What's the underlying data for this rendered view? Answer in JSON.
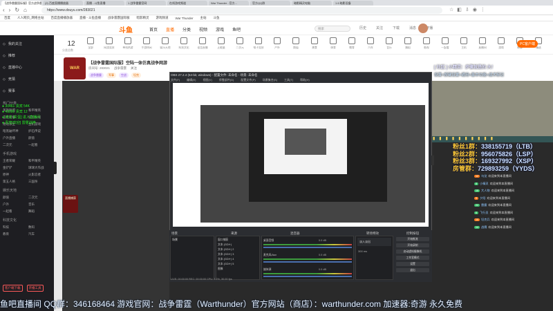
{
  "browser": {
    "tabs": [
      "【战争雷霆国际服】官方战争雷霆...",
      "(2) 百度直播播放器",
      "直播 - 斗鱼直播",
      "1 战争雷霆官网",
      "在线游戏频道",
      "War Thunder - 官方...",
      "官方QQ群",
      "暗影精灵电脑",
      "1 6 暗影设备"
    ],
    "url": "https://www.douyu.com/283021",
    "bookmarks": [
      "百度",
      "人人网页_网络主站",
      "百度直播播放器",
      "直播 - 斗鱼直播",
      "战争雷霆国际服",
      "暗影精灵",
      "游戏频道",
      "War Thunder",
      "主站",
      "斗鱼"
    ]
  },
  "site": {
    "logo": "斗鱼",
    "nav": [
      "首页",
      "直播",
      "分类",
      "视频",
      "游戏",
      "鱼吧"
    ],
    "nav_selected": 1,
    "search_placeholder": "搜索",
    "header_icons": [
      "历史",
      "关注",
      "下载",
      "消息",
      "开播"
    ]
  },
  "sidebar": {
    "items": [
      "我的关注",
      "推荐",
      "直播中心",
      "竞猜",
      "赛事"
    ],
    "section1": "热门分类",
    "grid1": [
      "英雄联盟",
      "和平精英",
      "王者荣耀",
      "穿越火线",
      "绝地求生",
      "主机游戏",
      "暗黑破坏神",
      "炉石传说",
      "户外直播",
      "颜值",
      "二次元",
      "一起看"
    ],
    "section2": "手机游戏",
    "grid2": [
      "王者荣耀",
      "和平精英",
      "金铲铲",
      "球球大作战",
      "原神",
      "火影忍者",
      "第五人格",
      "三国杀"
    ],
    "section3": "娱乐天地",
    "grid3": [
      "颜值",
      "二次元",
      "户外",
      "音乐",
      "一起看",
      "舞蹈"
    ],
    "section4": "科技文化",
    "grid4": [
      "科技",
      "数码",
      "教育",
      "汽车"
    ],
    "btn1": "客户端下载",
    "btn2": "开播工具"
  },
  "category_bar": {
    "count": "12",
    "count_label": "分类总数",
    "items": [
      "全部",
      "网游竞技",
      "单机热游",
      "手游休闲",
      "娱乐天地",
      "科技文化",
      "语音直播",
      "正能量",
      "二次元",
      "电子竞技",
      "户外",
      "颜值",
      "美食",
      "体育",
      "教育",
      "汽车",
      "音乐",
      "舞蹈",
      "影视",
      "一起看",
      "主机",
      "直播间",
      "游戏",
      "新游",
      "精选"
    ],
    "pc_button": "PC客户端"
  },
  "stream": {
    "avatar_text": "WAR THUNDER",
    "title": "【战争雷霆国际服】空陆一体仿真战争网游",
    "room_label": "房间号: 283021",
    "category": "战争雷霆",
    "followers": "关注",
    "tags": [
      "战争雷霆",
      "军事",
      "空战",
      "坦克"
    ],
    "top_right_text": "[ 社区 ] 小精灵：步骤就是的 大！",
    "top_right_text2": "设置>按键设置>通用>基本功能>战术标记"
  },
  "obs": {
    "title": "OBS 27.2.4 (64-bit, windows) - 配置文件: 未命名 - 场景: 未命名",
    "menu": [
      "文件(F)",
      "编辑(E)",
      "视图(V)",
      "停靠部件(D)",
      "配置文件(P)",
      "场景集合(S)",
      "工具(T)",
      "帮助(H)"
    ],
    "docks": [
      "场景",
      "来源",
      "混音器",
      "转场特效",
      "控制按钮"
    ],
    "scene": "场景",
    "sources": [
      "窗口捕获",
      "文本 (GDI+)",
      "文本 (GDI+) 2",
      "文本 (GDI+) 3",
      "文本 (GDI+) 4",
      "文本 (GDI+) 5",
      "图像"
    ],
    "mixer": [
      "桌面音频",
      "麦克风/Aux",
      "媒体源"
    ],
    "mixer_values": [
      "0.0 dB",
      "0.0 dB",
      "0.0 dB"
    ],
    "transition": "淡入淡出",
    "duration": "300 ms",
    "controls": [
      "开始推流",
      "开始录制",
      "启动虚拟摄像机",
      "工作室模式",
      "设置",
      "退出"
    ],
    "status": "LIVE: 00:00:00  REC: 00:00:00  CPU: 3.2%, 30.00 fps"
  },
  "overlay": {
    "fans": [
      {
        "label": "粉丝1群：",
        "value": "338155719（LTB）"
      },
      {
        "label": "粉丝2群：",
        "value": "956075826（LSP）"
      },
      {
        "label": "粉丝3群：",
        "value": "169327992（XSP）"
      },
      {
        "label": "房管群：",
        "value": "729893259（YYDS）"
      }
    ],
    "chats": [
      {
        "level": "12",
        "user": "乌龙",
        "text": "欢迎来到本直播间"
      },
      {
        "level": "8",
        "user": "小精灵",
        "text": "欢迎来到本直播间"
      },
      {
        "level": "15",
        "user": "大人物",
        "text": "欢迎来到本直播间"
      },
      {
        "level": "9",
        "user": "夕阳",
        "text": "欢迎来到本直播间"
      },
      {
        "level": "22",
        "user": "雷霆",
        "text": "欢迎来到本直播间"
      },
      {
        "level": "6",
        "user": "飞行员",
        "text": "欢迎来到本直播间"
      },
      {
        "level": "10",
        "user": "坦克兵",
        "text": "欢迎来到本直播间"
      },
      {
        "level": "14",
        "user": "战鹰",
        "text": "欢迎来到本直播间"
      }
    ],
    "green_lines": [
      "● 30461  贵宾  54K",
      "● 43000  贵宾 12",
      "● 欢迎 [彩蛋] 进入直播间",
      "● 贵宾[欢迎] 雷霆战神"
    ],
    "red_avatar": "直播捕获",
    "marquee": "鱼吧直播间  QQ群：346168464  游戏官网：战争雷霆（Warthunder）官方网站（商店）：warthunder.com  加速器:奇游  永久免费",
    "top_strip": "▮▮▮▮▮▮▮▮▮▮"
  },
  "colors": {
    "accent": "#ff6a00",
    "sidebar_bg": "#1e1e22",
    "obs_bg": "#2b2d31"
  }
}
